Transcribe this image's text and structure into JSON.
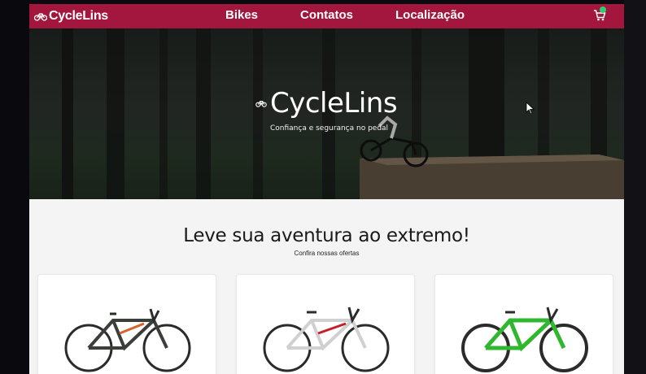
{
  "navbar": {
    "brand": "CycleLins",
    "links": [
      "Bikes",
      "Contatos",
      "Localização"
    ],
    "cart_icon": "cart-icon"
  },
  "hero": {
    "title": "CycleLins",
    "subtitle": "Confiança e segurança no pedal"
  },
  "offers": {
    "title": "Leve sua aventura ao extremo!",
    "subtitle": "Confira nossas ofertas",
    "products": [
      {
        "icon": "bike-icon",
        "frame_color": "#3a3f3a",
        "accent_color": "#d8622a"
      },
      {
        "icon": "bike-icon",
        "frame_color": "#e9e9e9",
        "accent_color": "#c81e2a"
      },
      {
        "icon": "bike-icon",
        "frame_color": "#2fb82f",
        "accent_color": "#1a1a1a"
      }
    ]
  },
  "colors": {
    "brand": "#a3163e",
    "badge": "#2ecc71"
  }
}
